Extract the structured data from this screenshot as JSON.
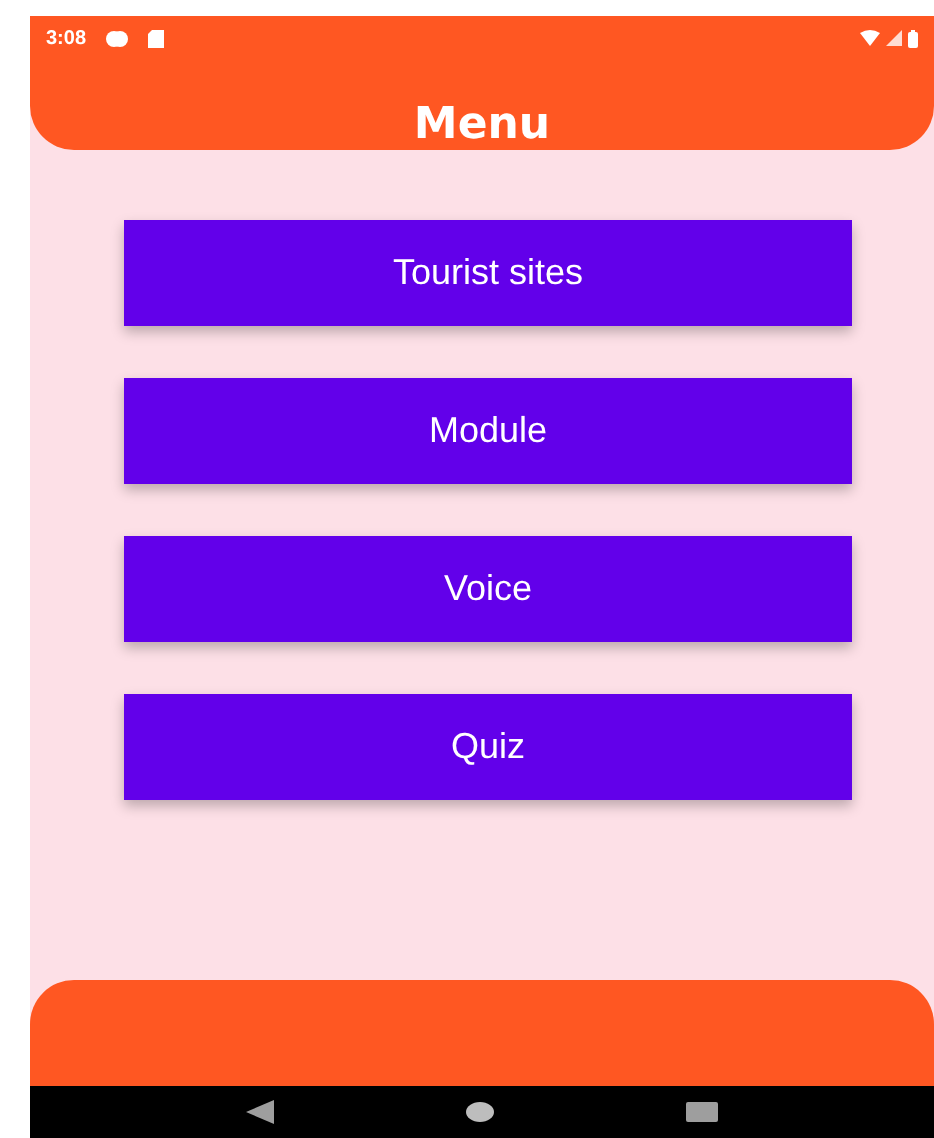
{
  "status_bar": {
    "time": "3:08"
  },
  "header": {
    "title": "Menu"
  },
  "menu_buttons": [
    {
      "label": "Tourist sites"
    },
    {
      "label": "Module"
    },
    {
      "label": "Voice"
    },
    {
      "label": "Quiz"
    }
  ],
  "nav_bar": {
    "buttons": [
      {
        "kind": "back"
      },
      {
        "kind": "home"
      },
      {
        "kind": "recents"
      }
    ]
  }
}
